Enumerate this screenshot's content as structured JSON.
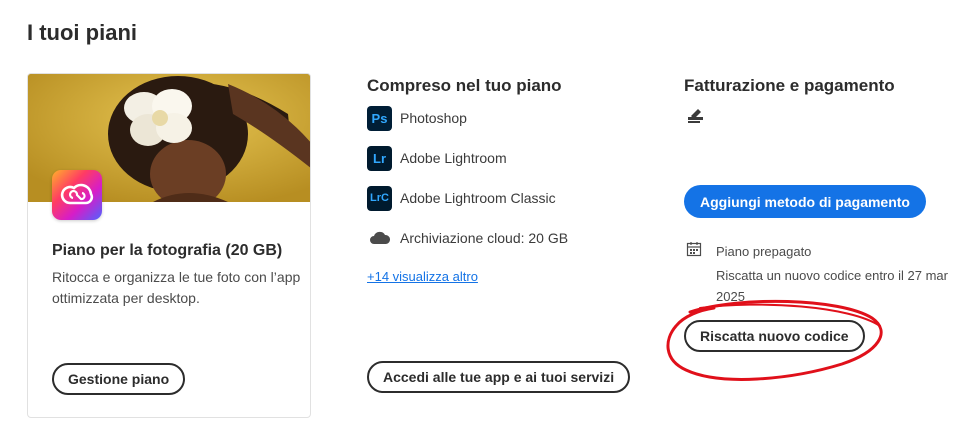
{
  "page": {
    "title": "I tuoi piani"
  },
  "plan": {
    "name": "Piano per la fotografia (20 GB)",
    "description": "Ritocca e organizza le tue foto con l’app ottimizzata per desktop.",
    "manage_label": "Gestione piano",
    "hero_icon": "creative-cloud-logo"
  },
  "included": {
    "title": "Compreso nel tuo piano",
    "items": [
      {
        "abbr": "Ps",
        "label": "Photoshop",
        "icon": "photoshop-icon"
      },
      {
        "abbr": "Lr",
        "label": "Adobe Lightroom",
        "icon": "lightroom-icon"
      },
      {
        "abbr": "LrC",
        "label": "Adobe Lightroom Classic",
        "icon": "lightroom-classic-icon"
      },
      {
        "abbr": "",
        "label": "Archiviazione cloud: 20 GB",
        "icon": "cloud-icon"
      }
    ],
    "more_link": "+14 visualizza altro",
    "access_label": "Accedi alle tue app e ai tuoi servizi"
  },
  "billing": {
    "title": "Fatturazione e pagamento",
    "add_payment_label": "Aggiungi metodo di pagamento",
    "prepaid_label": "Piano prepagato",
    "redeem_info": "Riscatta un nuovo codice entro il 27 mar 2025",
    "redeem_label": "Riscatta nuovo codice"
  },
  "colors": {
    "accent": "#1473e6",
    "annotation": "#e0101a",
    "app_icon_bg": "#001e36",
    "app_icon_fg": "#31a8ff"
  }
}
